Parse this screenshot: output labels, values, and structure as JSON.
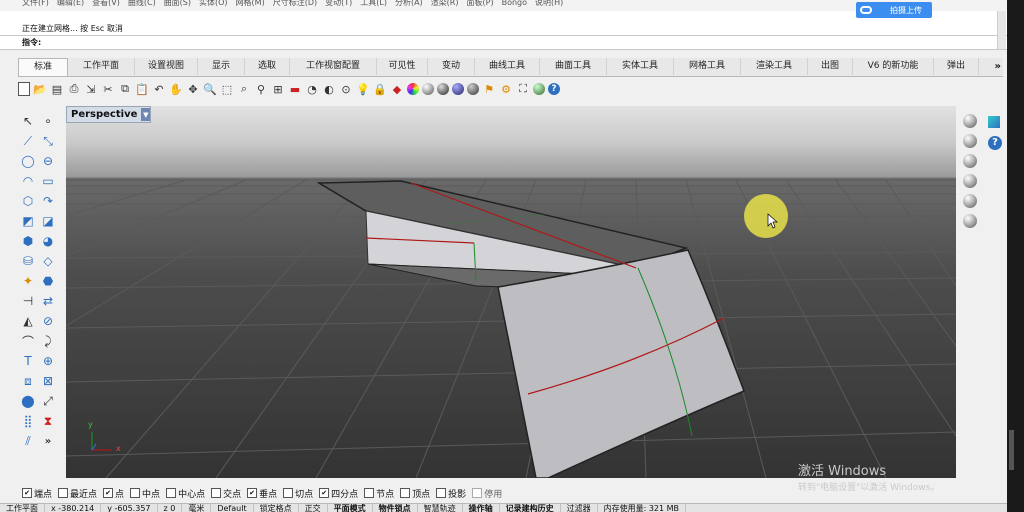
{
  "menu": [
    "文件(F)",
    "编辑(E)",
    "查看(V)",
    "曲线(C)",
    "曲面(S)",
    "实体(O)",
    "网格(M)",
    "尺寸标注(D)",
    "变动(T)",
    "工具(L)",
    "分析(A)",
    "渲染(R)",
    "面板(P)",
    "Bongo",
    "说明(H)"
  ],
  "command_history": {
    "line2": "正在建立网格... 按 Esc 取消"
  },
  "command_prompt": "指令:",
  "upload_button": "拍摄上传",
  "tabs": [
    "标准",
    "工作平面",
    "设置视图",
    "显示",
    "选取",
    "工作视窗配置",
    "可见性",
    "变动",
    "曲线工具",
    "曲面工具",
    "实体工具",
    "网格工具",
    "渲染工具",
    "出图",
    "V6 的新功能",
    "弹出"
  ],
  "tabs_more": "»",
  "viewport_title": "Perspective",
  "viewport_dropdown": "▼",
  "axis": {
    "y": "y",
    "x": "x"
  },
  "watermark": {
    "line1": "激活 Windows",
    "line2": "转到\"电脑设置\"以激活 Windows。"
  },
  "osnaps": [
    {
      "label": "端点",
      "checked": true
    },
    {
      "label": "最近点",
      "checked": false
    },
    {
      "label": "点",
      "checked": true
    },
    {
      "label": "中点",
      "checked": false
    },
    {
      "label": "中心点",
      "checked": false
    },
    {
      "label": "交点",
      "checked": false
    },
    {
      "label": "垂点",
      "checked": true
    },
    {
      "label": "切点",
      "checked": false
    },
    {
      "label": "四分点",
      "checked": true
    },
    {
      "label": "节点",
      "checked": false
    },
    {
      "label": "顶点",
      "checked": false
    },
    {
      "label": "投影",
      "checked": false
    },
    {
      "label": "停用",
      "checked": false
    }
  ],
  "status": {
    "cplane": "工作平面",
    "x": "x -380.214",
    "y": "y -605.357",
    "z": "z 0",
    "unit": "毫米",
    "layer": "Default",
    "lock_grid": "锁定格点",
    "ortho": "正交",
    "planar": "平面模式",
    "osnap": "物件锁点",
    "smarttrack": "智慧轨迹",
    "gumball": "操作轴",
    "history": "记录建构历史",
    "filter": "过滤器",
    "memory": "内存使用量: 321 MB"
  },
  "colors": {
    "accent": "#3b8ef0",
    "viewport_title_bg": "#d4dce8",
    "seam_red": "#b01818",
    "seam_green": "#1d8a2a"
  }
}
